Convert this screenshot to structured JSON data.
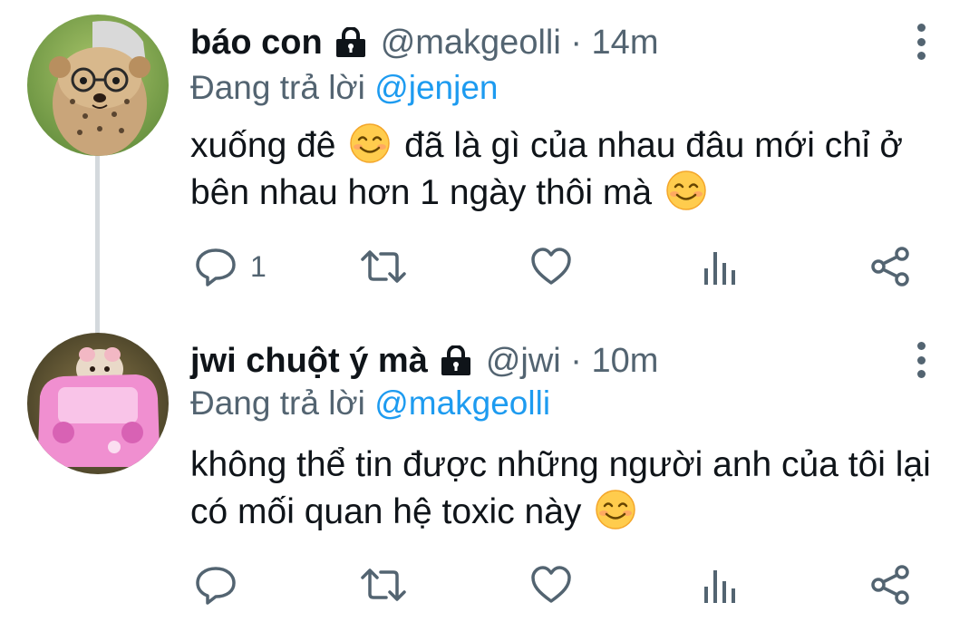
{
  "tweets": [
    {
      "name": "báo con",
      "handle": "@makgeolli · 14m",
      "reply_prefix": "Đang trả lời ",
      "reply_to": "@jenjen",
      "text_part1": "xuống đê",
      "text_part2": "đã là gì của nhau đâu mới chỉ ở bên nhau hơn 1 ngày thôi mà",
      "reply_count": "1",
      "avatar_icon": "cheetah-cub-with-glasses"
    },
    {
      "name": "jwi chuột ý mà",
      "handle": "@jwi · 10m",
      "reply_prefix": "Đang trả lời ",
      "reply_to": "@makgeolli",
      "text_part1": "không thể tin được những người anh của tôi lại có mối quan hệ toxic này",
      "reply_count": "",
      "avatar_icon": "hamster-in-pink-toy-car"
    }
  ],
  "icons": [
    "lock-icon",
    "more-options-icon",
    "reply-icon",
    "retweet-icon",
    "like-icon",
    "analytics-icon",
    "share-icon",
    "smiling-face-emoji"
  ],
  "colors": {
    "text": "#0f1419",
    "secondary": "#536471",
    "link": "#1d9bf0",
    "thread_line": "#d4d9dd"
  }
}
